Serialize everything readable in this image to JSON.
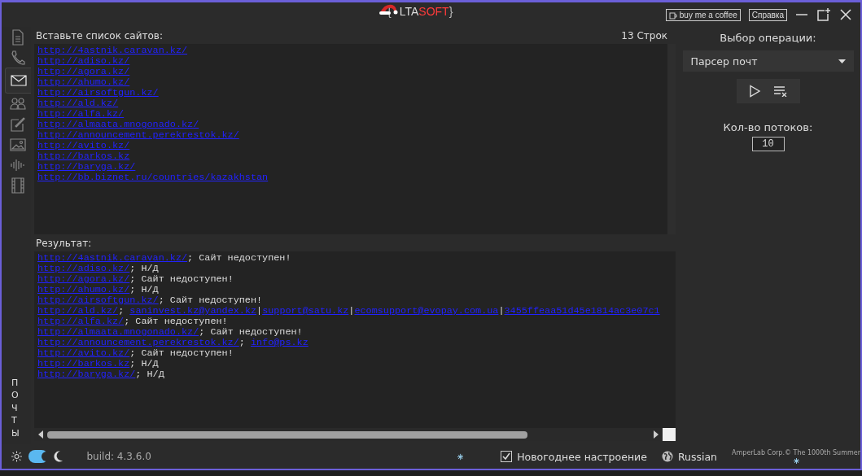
{
  "title_bar": {
    "logo": [
      {
        "kind": "brace",
        "text": "{"
      },
      {
        "kind": "plain",
        "text": "LTA"
      },
      {
        "kind": "accent",
        "text": "SOFT"
      },
      {
        "kind": "brace",
        "text": "}"
      }
    ],
    "coffee_button": "buy me a coffee",
    "help_button": "Справка"
  },
  "sidebar": {
    "items": [
      {
        "kind": "document",
        "selected": false
      },
      {
        "kind": "phone",
        "selected": false
      },
      {
        "kind": "mail",
        "selected": true
      },
      {
        "kind": "people",
        "selected": false
      },
      {
        "kind": "edit",
        "selected": false
      },
      {
        "kind": "image",
        "selected": false
      },
      {
        "kind": "audio",
        "selected": false
      },
      {
        "kind": "film",
        "selected": false
      }
    ],
    "section_label": "ПОЧТЫ"
  },
  "input_panel": {
    "label": "Вставьте список сайтов:",
    "line_count": "13 Строк",
    "lines": [
      "http://4astnik.caravan.kz/",
      "http://adiso.kz/",
      "http://agora.kz/",
      "http://ahumo.kz/",
      "http://airsoftgun.kz/",
      "http://ald.kz/",
      "http://alfa.kz/",
      "http://almaata.mnogonado.kz/",
      "http://announcement.perekrestok.kz/",
      "http://avito.kz/",
      "http://barkos.kz",
      "http://baryga.kz/",
      "http://bb.biznet.ru/countries/kazakhstan"
    ]
  },
  "result_panel": {
    "label": "Результат:",
    "rows": [
      {
        "segments": [
          {
            "kind": "link",
            "text": "http://4astnik.caravan.kz/"
          },
          {
            "kind": "text",
            "text": "; Сайт недоступен!"
          }
        ]
      },
      {
        "segments": [
          {
            "kind": "link",
            "text": "http://adiso.kz/"
          },
          {
            "kind": "text",
            "text": "; Н/Д"
          }
        ]
      },
      {
        "segments": [
          {
            "kind": "link",
            "text": "http://agora.kz/"
          },
          {
            "kind": "text",
            "text": "; Сайт недоступен!"
          }
        ]
      },
      {
        "segments": [
          {
            "kind": "link",
            "text": "http://ahumo.kz/"
          },
          {
            "kind": "text",
            "text": "; Н/Д"
          }
        ]
      },
      {
        "segments": [
          {
            "kind": "link",
            "text": "http://airsoftgun.kz/"
          },
          {
            "kind": "text",
            "text": "; Сайт недоступен!"
          }
        ]
      },
      {
        "segments": [
          {
            "kind": "link",
            "text": "http://ald.kz/"
          },
          {
            "kind": "text",
            "text": "; "
          },
          {
            "kind": "link",
            "text": "saninvest.kz@yandex.kz"
          },
          {
            "kind": "text",
            "text": "|"
          },
          {
            "kind": "link",
            "text": "support@satu.kz"
          },
          {
            "kind": "text",
            "text": "|"
          },
          {
            "kind": "link",
            "text": "ecomsupport@evopay.com.ua"
          },
          {
            "kind": "text",
            "text": "|"
          },
          {
            "kind": "link",
            "text": "3455ffeaa51d45e1814ac3e07c1"
          }
        ]
      },
      {
        "segments": [
          {
            "kind": "link",
            "text": "http://alfa.kz/"
          },
          {
            "kind": "text",
            "text": "; Сайт недоступен!"
          }
        ]
      },
      {
        "segments": [
          {
            "kind": "link",
            "text": "http://almaata.mnogonado.kz/"
          },
          {
            "kind": "text",
            "text": "; Сайт недоступен!"
          }
        ]
      },
      {
        "segments": [
          {
            "kind": "link",
            "text": "http://announcement.perekrestok.kz/"
          },
          {
            "kind": "text",
            "text": "; "
          },
          {
            "kind": "link",
            "text": "info@ps.kz"
          }
        ]
      },
      {
        "segments": [
          {
            "kind": "link",
            "text": "http://avito.kz/"
          },
          {
            "kind": "text",
            "text": "; Сайт недоступен!"
          }
        ]
      },
      {
        "segments": [
          {
            "kind": "link",
            "text": "http://barkos.kz"
          },
          {
            "kind": "text",
            "text": "; Н/Д"
          }
        ]
      },
      {
        "segments": [
          {
            "kind": "link",
            "text": "http://baryga.kz/"
          },
          {
            "kind": "text",
            "text": "; Н/Д"
          }
        ]
      }
    ]
  },
  "operation_panel": {
    "label": "Выбор операции:",
    "operation": "Парсер почт",
    "threads_label": "Кол-во потоков:",
    "threads": "10"
  },
  "status_bar": {
    "dark_theme": true,
    "build": "build: 4.3.6.0",
    "new_year_mood": {
      "label": "Новогоднее настроение",
      "checked": true
    },
    "language": "Russian",
    "copyright": "AmperLab Corp.© The 1000th Summer"
  }
}
